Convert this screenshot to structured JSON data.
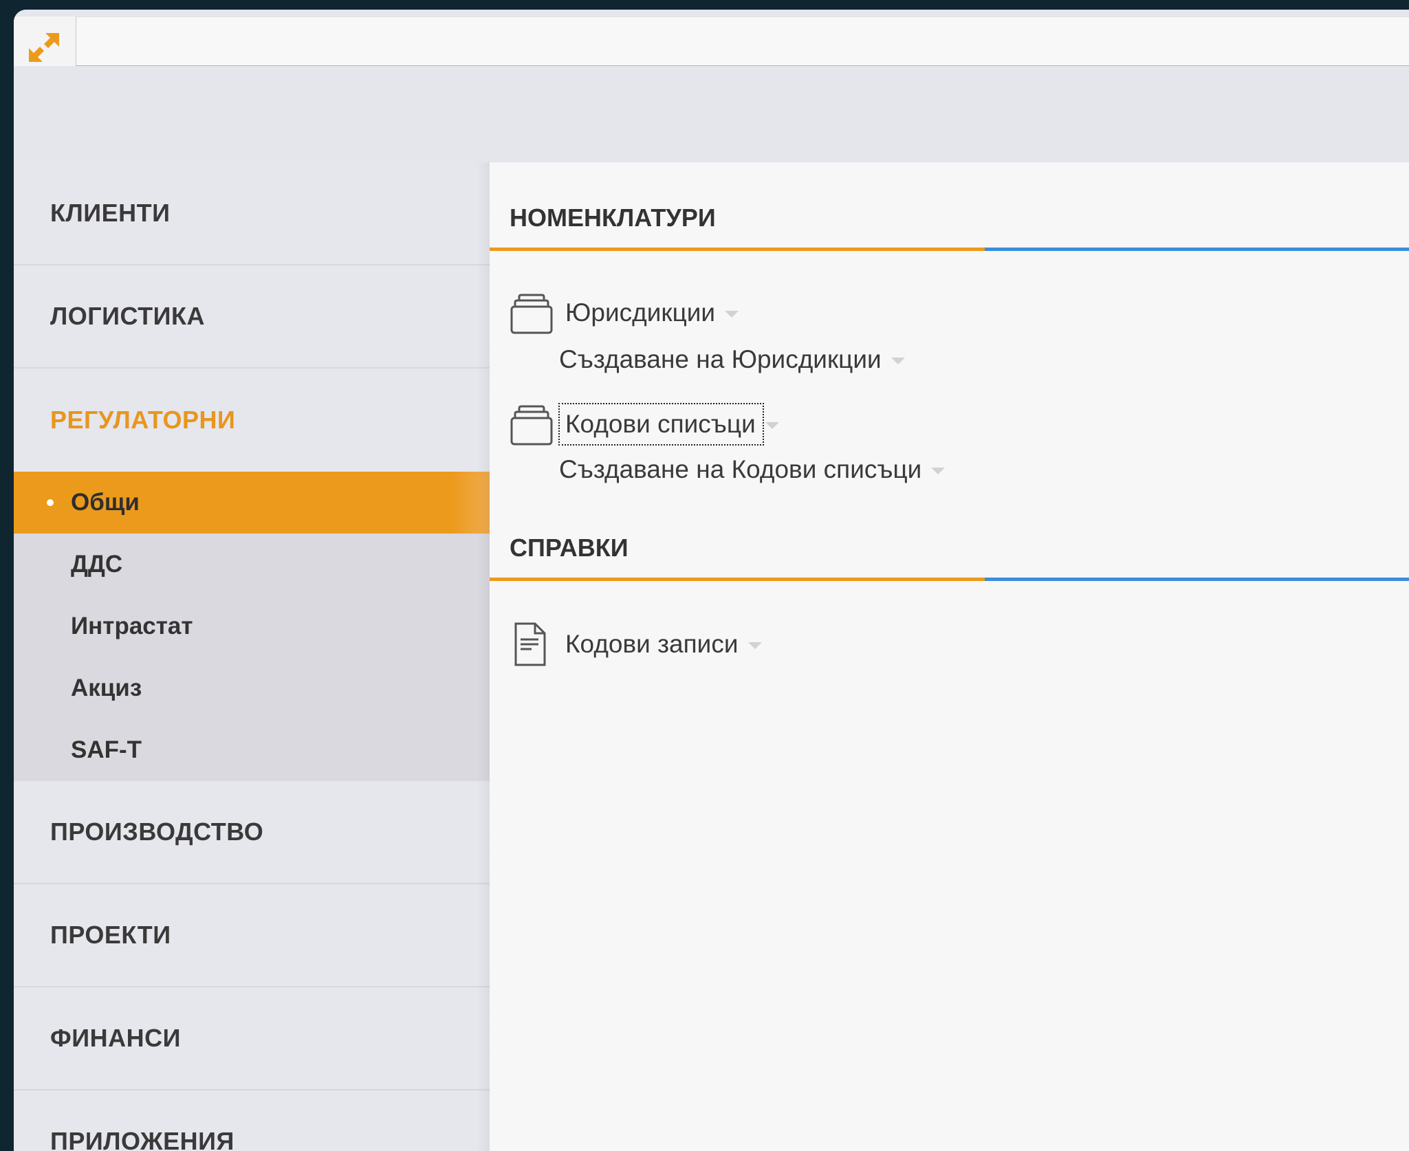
{
  "sidebar": {
    "sections": [
      {
        "label": "КЛИЕНТИ"
      },
      {
        "label": "ЛОГИСТИКА"
      },
      {
        "label": "РЕГУЛАТОРНИ"
      }
    ],
    "subitems": [
      {
        "label": "Общи"
      },
      {
        "label": "ДДС"
      },
      {
        "label": "Интрастат"
      },
      {
        "label": "Акциз"
      },
      {
        "label": "SAF-T"
      }
    ],
    "sections_after": [
      {
        "label": "ПРОИЗВОДСТВО"
      },
      {
        "label": "ПРОЕКТИ"
      },
      {
        "label": "ФИНАНСИ"
      },
      {
        "label": "ПРИЛОЖЕНИЯ"
      }
    ]
  },
  "main": {
    "groups": [
      {
        "title": "НОМЕНКЛАТУРИ",
        "items": [
          {
            "label": "Юрисдикции",
            "create_label": "Създаване на Юрисдикции"
          },
          {
            "label": "Кодови списъци",
            "create_label": "Създаване на Кодови списъци"
          }
        ]
      },
      {
        "title": "СПРАВКИ",
        "items": [
          {
            "label": "Кодови записи"
          }
        ]
      }
    ]
  },
  "colors": {
    "accent": "#ec9a1c",
    "secondary": "#3a8de0",
    "background": "#0f2530"
  }
}
